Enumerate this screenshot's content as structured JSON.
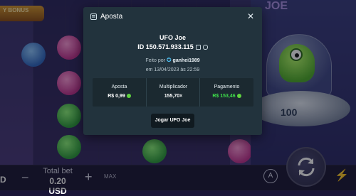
{
  "background": {
    "bonus_banner": "Y BONUS",
    "machine_label": "100",
    "logo_text": "JOE"
  },
  "bottom_bar": {
    "left_text": "D",
    "minus": "−",
    "total_bet_label": "Total bet",
    "total_bet_value": "0.20 USD",
    "plus": "+",
    "max_label": "MAX",
    "auto_label": "A"
  },
  "modal": {
    "title": "Aposta",
    "game_name": "UFO Joe",
    "bet_id": "ID 150.571.933.115",
    "played_by_prefix": "Feito por",
    "player_name": "ganhei1989",
    "date_line": "em 13/04/2023 às 22:59",
    "stats": {
      "bet_label": "Aposta",
      "bet_value": "R$ 0,99",
      "multiplier_label": "Multiplicador",
      "multiplier_value": "155,70×",
      "payout_label": "Pagamento",
      "payout_value": "R$ 153,46"
    },
    "play_button": "Jogar UFO Joe"
  },
  "colors": {
    "modal_bg": "#22333d",
    "stats_bg": "#1b2930",
    "payout_green": "#3edc4a",
    "button_bg": "#101a20"
  }
}
